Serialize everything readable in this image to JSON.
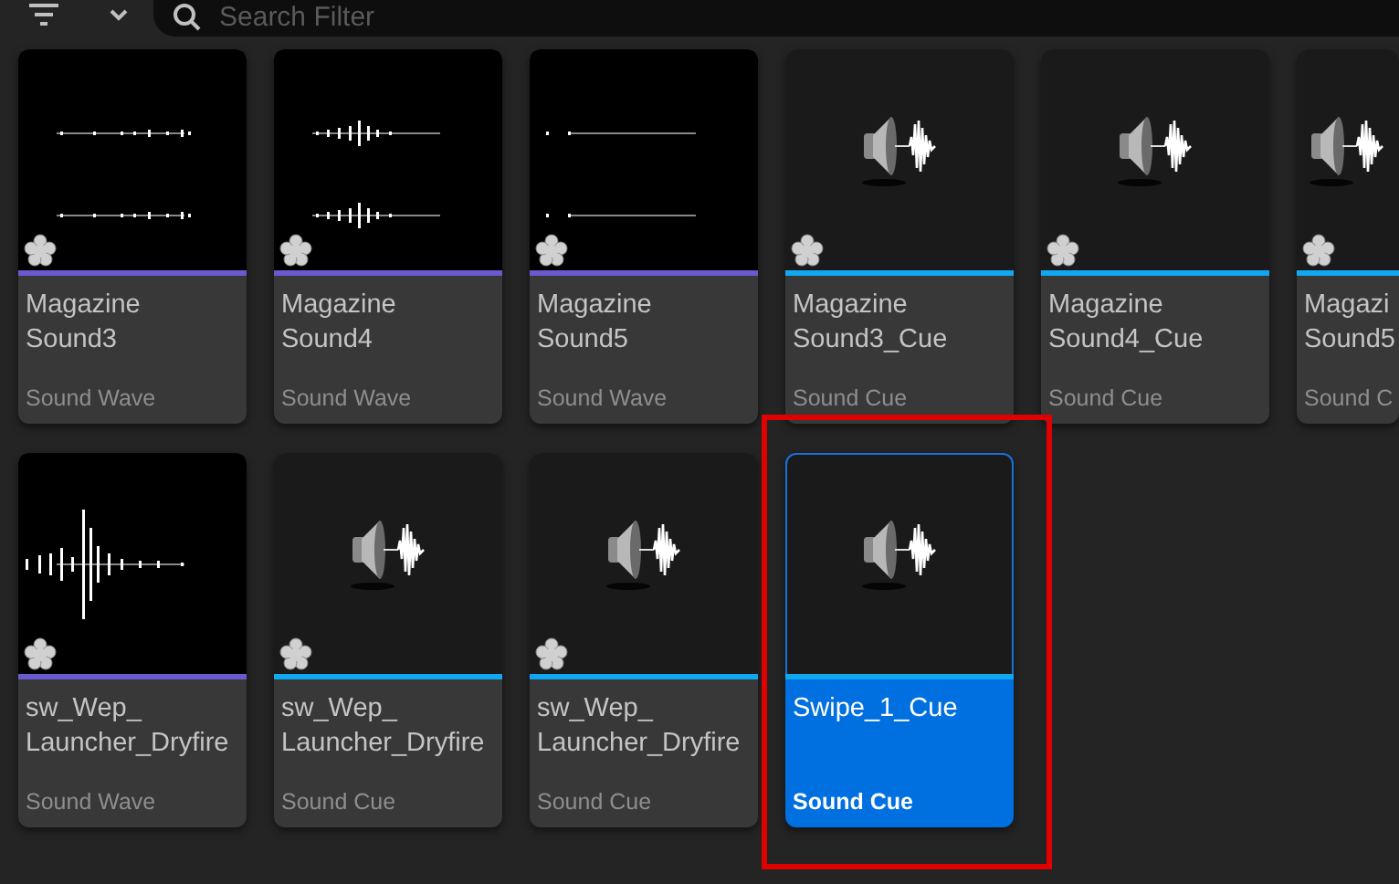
{
  "toolbar": {
    "search": {
      "placeholder": "Search Filter"
    }
  },
  "assets": [
    {
      "name": [
        "Magazine",
        "Sound3"
      ],
      "type": "Sound Wave",
      "kind": "wave",
      "color": "#6a5ad0",
      "marked": true,
      "selected": false,
      "highlighted": false
    },
    {
      "name": [
        "Magazine",
        "Sound4"
      ],
      "type": "Sound Wave",
      "kind": "wave",
      "color": "#6a5ad0",
      "marked": true,
      "selected": false,
      "highlighted": false
    },
    {
      "name": [
        "Magazine",
        "Sound5"
      ],
      "type": "Sound Wave",
      "kind": "wave",
      "color": "#6a5ad0",
      "marked": true,
      "selected": false,
      "highlighted": false
    },
    {
      "name": [
        "Magazine",
        "Sound3_Cue"
      ],
      "type": "Sound Cue",
      "kind": "cue",
      "color": "#10a8f0",
      "marked": true,
      "selected": false,
      "highlighted": false
    },
    {
      "name": [
        "Magazine",
        "Sound4_Cue"
      ],
      "type": "Sound Cue",
      "kind": "cue",
      "color": "#10a8f0",
      "marked": true,
      "selected": false,
      "highlighted": false
    },
    {
      "name": [
        "Magazi",
        "Sound5"
      ],
      "type": "Sound C",
      "kind": "cue",
      "color": "#10a8f0",
      "marked": true,
      "selected": false,
      "highlighted": false
    },
    {
      "name": [
        "sw_Wep_",
        "Launcher_Dryfire"
      ],
      "type": "Sound Wave",
      "kind": "wave",
      "color": "#6a5ad0",
      "marked": true,
      "selected": false,
      "highlighted": false
    },
    {
      "name": [
        "sw_Wep_",
        "Launcher_Dryfire"
      ],
      "type": "Sound Cue",
      "kind": "cue",
      "color": "#10a8f0",
      "marked": true,
      "selected": false,
      "highlighted": false
    },
    {
      "name": [
        "sw_Wep_",
        "Launcher_Dryfire"
      ],
      "type": "Sound Cue",
      "kind": "cue",
      "color": "#10a8f0",
      "marked": true,
      "selected": false,
      "highlighted": false
    },
    {
      "name": [
        "Swipe_1_Cue"
      ],
      "type": "Sound Cue",
      "kind": "cue",
      "color": "#10a8f0",
      "marked": false,
      "selected": true,
      "highlighted": true
    }
  ]
}
